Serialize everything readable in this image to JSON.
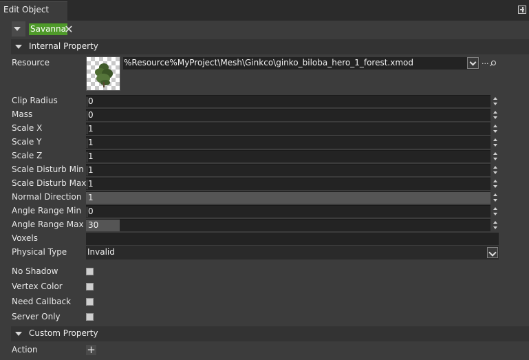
{
  "window": {
    "tab_title": "Edit Object"
  },
  "object": {
    "name": "Savanna"
  },
  "sections": {
    "internal": "Internal Property",
    "custom": "Custom Property"
  },
  "resource": {
    "label": "Resource",
    "path": "%Resource%MyProject\\Mesh\\Ginkco\\ginko_biloba_hero_1_forest.xmod",
    "more": "..."
  },
  "fields": {
    "clip_radius": {
      "label": "Clip Radius",
      "value": "0"
    },
    "mass": {
      "label": "Mass",
      "value": "0"
    },
    "scale_x": {
      "label": "Scale X",
      "value": "1"
    },
    "scale_y": {
      "label": "Scale Y",
      "value": "1"
    },
    "scale_z": {
      "label": "Scale Z",
      "value": "1"
    },
    "scale_disturb_min": {
      "label": "Scale Disturb Min",
      "value": "1"
    },
    "scale_disturb_max": {
      "label": "Scale Disturb Max",
      "value": "1"
    },
    "normal_direction": {
      "label": "Normal Direction",
      "value": "1",
      "fill_fraction": 1.0
    },
    "angle_range_min": {
      "label": "Angle Range Min",
      "value": "0"
    },
    "angle_range_max": {
      "label": "Angle Range Max",
      "value": "30",
      "fill_fraction": 0.083
    },
    "voxels": {
      "label": "Voxels",
      "value": ""
    },
    "physical_type": {
      "label": "Physical Type",
      "value": "Invalid"
    }
  },
  "checkboxes": {
    "no_shadow": {
      "label": "No Shadow",
      "checked": false
    },
    "vertex_color": {
      "label": "Vertex Color",
      "checked": false
    },
    "need_callback": {
      "label": "Need Callback",
      "checked": false
    },
    "server_only": {
      "label": "Server Only",
      "checked": false
    }
  },
  "custom": {
    "action_label": "Action",
    "add_icon": "+"
  },
  "colors": {
    "background": "#3c3c3c",
    "field": "#232323",
    "accent_green": "#4f9a2a",
    "section_bar": "#333333"
  },
  "icons": [
    "pin-icon",
    "collapse-triangle-icon",
    "close-icon",
    "dropdown-chevron-icon",
    "search-icon",
    "plus-icon",
    "spinner-icon"
  ]
}
